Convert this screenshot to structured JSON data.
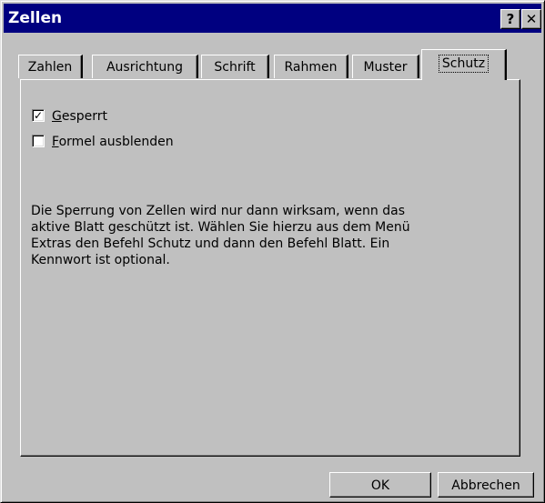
{
  "window": {
    "title": "Zellen",
    "help_button": "?",
    "close_button": "✕"
  },
  "tabs": [
    {
      "label": "Zahlen",
      "active": false
    },
    {
      "label": "Ausrichtung",
      "active": false
    },
    {
      "label": "Schrift",
      "active": false
    },
    {
      "label": "Rahmen",
      "active": false
    },
    {
      "label": "Muster",
      "active": false
    },
    {
      "label": "Schutz",
      "active": true
    }
  ],
  "protection": {
    "locked": {
      "accel": "G",
      "rest": "esperrt",
      "checked": true,
      "mark": "✓"
    },
    "hide_formula": {
      "accel": "F",
      "rest": "ormel ausblenden",
      "checked": false,
      "mark": ""
    }
  },
  "info_lines": [
    "Die Sperrung von Zellen wird nur dann wirksam, wenn das",
    "aktive Blatt geschützt ist. Wählen Sie hierzu aus dem Menü",
    "Extras den Befehl Schutz und dann den Befehl Blatt. Ein",
    "Kennwort ist optional."
  ],
  "buttons": {
    "ok": "OK",
    "cancel": "Abbrechen"
  }
}
